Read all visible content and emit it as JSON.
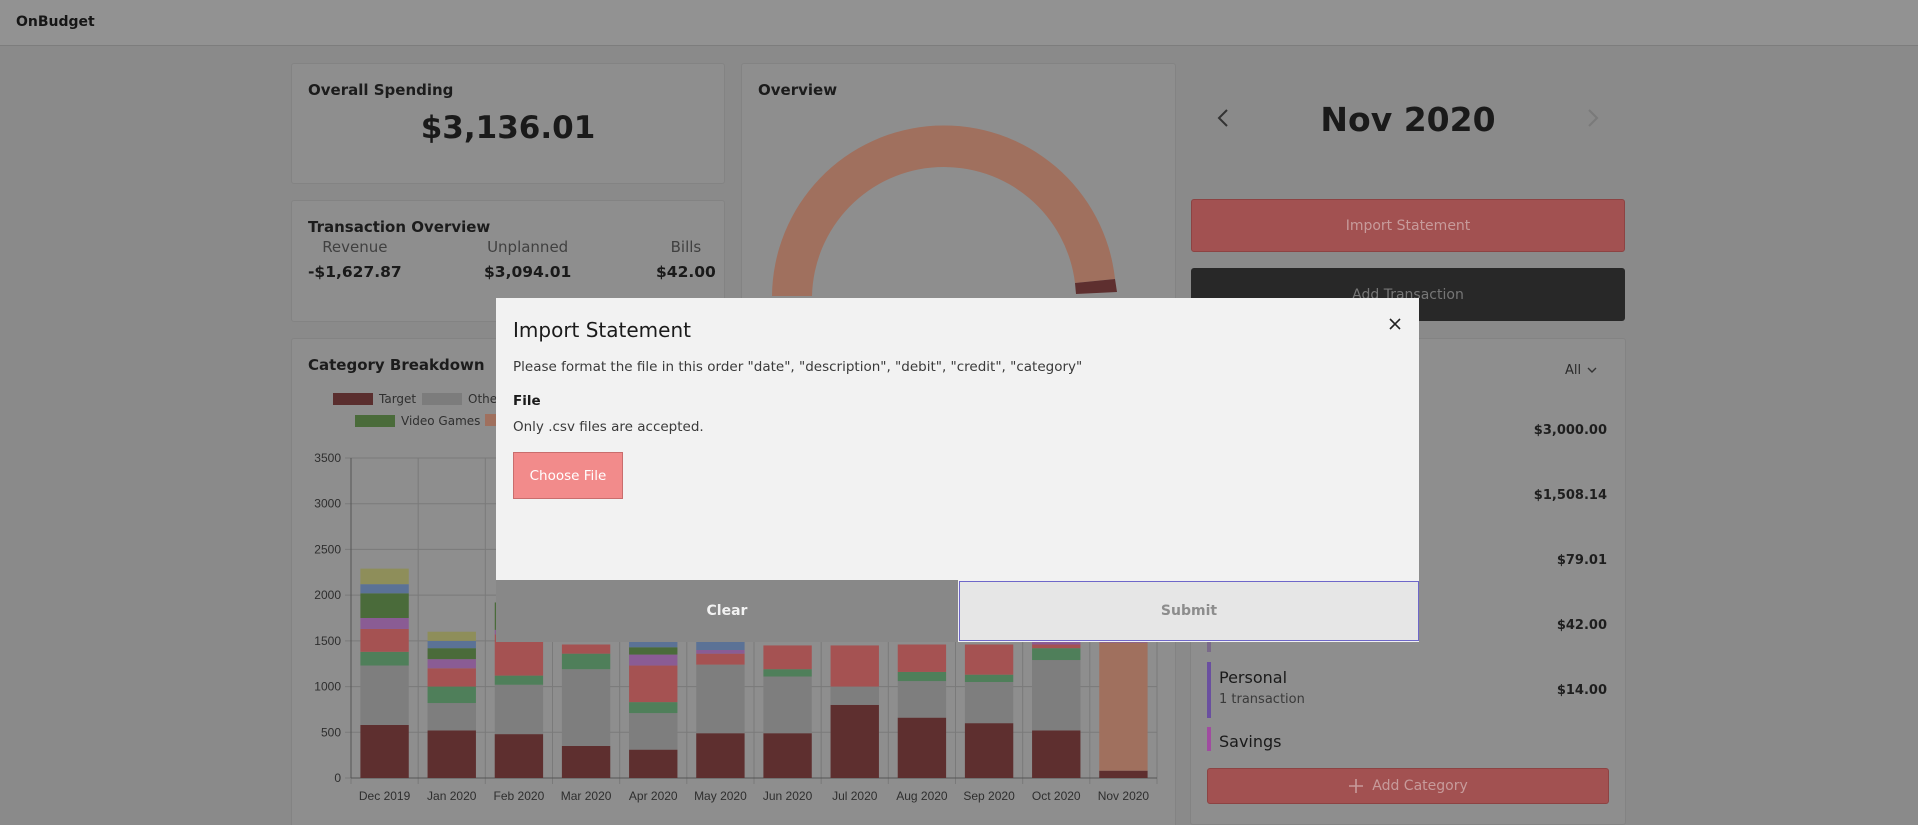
{
  "app": {
    "brand": "OnBudget"
  },
  "overall": {
    "title": "Overall Spending",
    "amount": "$3,136.01"
  },
  "transactions": {
    "title": "Transaction Overview",
    "revenue_label": "Revenue",
    "revenue_value": "-$1,627.87",
    "unplanned_label": "Unplanned",
    "unplanned_value": "$3,094.01",
    "bills_label": "Bills",
    "bills_value": "$42.00"
  },
  "overview": {
    "title": "Overview"
  },
  "category_breakdown": {
    "title": "Category Breakdown",
    "legend": [
      {
        "label": "Target",
        "color": "#5a2e2e"
      },
      {
        "label": "Other",
        "color": "#7c7c7c"
      },
      {
        "label": "Video Games",
        "color": "#4a6b3a"
      },
      {
        "label": "",
        "color": "#a0705e"
      }
    ]
  },
  "month_nav": {
    "title": "Nov 2020",
    "prev_icon": "chevron-left-icon",
    "next_icon": "chevron-right-icon"
  },
  "buttons": {
    "import": "Import Statement",
    "add_transaction": "Add Transaction",
    "add_category": "Add Category"
  },
  "categories_panel": {
    "filter": "All",
    "amounts": [
      "$3,000.00",
      "$1,508.14",
      "$79.01",
      "$42.00",
      "$14.00"
    ],
    "personal": {
      "name": "Personal",
      "sub": "1 transaction",
      "amount": "$14.00"
    },
    "savings": {
      "name": "Savings"
    }
  },
  "modal": {
    "title": "Import Statement",
    "description": "Please format the file in this order \"date\", \"description\", \"debit\", \"credit\", \"category\"",
    "file_label": "File",
    "file_hint": "Only .csv files are accepted.",
    "choose_file": "Choose File",
    "clear": "Clear",
    "submit": "Submit"
  },
  "chart_data": {
    "type": "bar",
    "stacked": true,
    "categories": [
      "Dec 2019",
      "Jan 2020",
      "Feb 2020",
      "Mar 2020",
      "Apr 2020",
      "May 2020",
      "Jun 2020",
      "Jul 2020",
      "Aug 2020",
      "Sep 2020",
      "Oct 2020",
      "Nov 2020"
    ],
    "ylim": [
      0,
      3500
    ],
    "yticks": [
      0,
      500,
      1000,
      1500,
      2000,
      2500,
      3000,
      3500
    ],
    "grid": true,
    "legend_position": "top",
    "series": [
      {
        "name": "Target",
        "color": "#5e2f2f",
        "values": [
          580,
          520,
          480,
          350,
          310,
          490,
          490,
          800,
          660,
          600,
          520,
          80
        ]
      },
      {
        "name": "Other",
        "color": "#7e7e7e",
        "values": [
          650,
          300,
          540,
          840,
          400,
          750,
          620,
          200,
          400,
          450,
          770,
          0
        ]
      },
      {
        "name": "",
        "color": "#4f7f5a",
        "values": [
          150,
          180,
          100,
          170,
          120,
          0,
          80,
          0,
          100,
          80,
          130,
          0
        ]
      },
      {
        "name": "",
        "color": "#a55252",
        "values": [
          250,
          200,
          450,
          100,
          400,
          120,
          260,
          450,
          300,
          330,
          40,
          0
        ]
      },
      {
        "name": "",
        "color": "#a0705e",
        "values": [
          0,
          0,
          0,
          0,
          0,
          0,
          0,
          0,
          0,
          0,
          0,
          1400
        ]
      },
      {
        "name": "",
        "color": "#8a5c94",
        "values": [
          120,
          100,
          50,
          0,
          120,
          40,
          0,
          0,
          0,
          0,
          30,
          20
        ]
      },
      {
        "name": "Video Games",
        "color": "#4a6b3a",
        "values": [
          270,
          120,
          300,
          0,
          80,
          0,
          0,
          0,
          0,
          0,
          0,
          0
        ]
      },
      {
        "name": "",
        "color": "#5b7296",
        "values": [
          100,
          80,
          0,
          0,
          60,
          110,
          0,
          0,
          0,
          0,
          0,
          0
        ]
      },
      {
        "name": "",
        "color": "#8e8e5a",
        "values": [
          170,
          100,
          0,
          0,
          0,
          0,
          0,
          0,
          0,
          0,
          0,
          0
        ]
      }
    ]
  }
}
